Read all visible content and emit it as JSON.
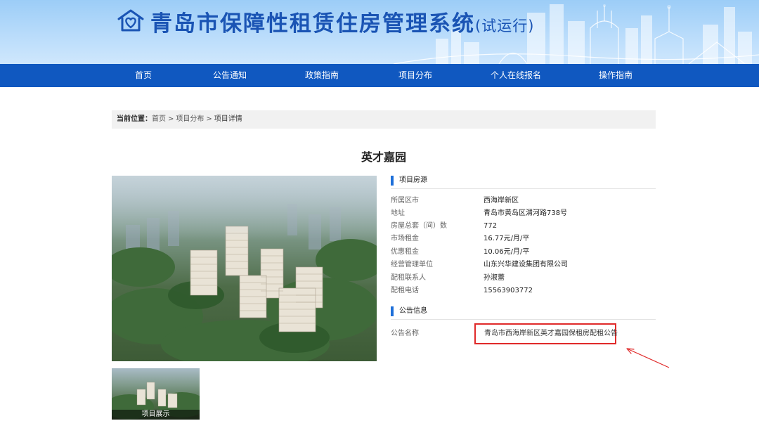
{
  "header": {
    "title": "青岛市保障性租赁住房管理系统",
    "title_suffix": "(试运行)",
    "logo_icon": "house-heart-icon"
  },
  "nav": {
    "items": [
      {
        "label": "首页"
      },
      {
        "label": "公告通知"
      },
      {
        "label": "政策指南"
      },
      {
        "label": "项目分布"
      },
      {
        "label": "个人在线报名"
      },
      {
        "label": "操作指南"
      }
    ]
  },
  "breadcrumb": {
    "label": "当前位置：",
    "items": [
      "首页",
      "项目分布",
      "项目详情"
    ],
    "separator": ">"
  },
  "project": {
    "title": "英才嘉园"
  },
  "gallery": {
    "thumb_caption": "项目展示"
  },
  "housing_section": {
    "heading": "项目房源",
    "rows": [
      {
        "key": "所属区市",
        "value": "西海岸新区"
      },
      {
        "key": "地址",
        "value": "青岛市黄岛区渭河路738号"
      },
      {
        "key": "房屋总套（间）数",
        "value": "772"
      },
      {
        "key": "市场租金",
        "value": "16.77元/月/平"
      },
      {
        "key": "优惠租金",
        "value": "10.06元/月/平"
      },
      {
        "key": "经营管理单位",
        "value": "山东兴华建设集团有限公司"
      },
      {
        "key": "配租联系人",
        "value": "孙淑蕾"
      },
      {
        "key": "配租电话",
        "value": "15563903772"
      }
    ]
  },
  "notice_section": {
    "heading": "公告信息",
    "rows": [
      {
        "key": "公告名称",
        "value": "青岛市西海岸新区英才嘉园保租房配租公告"
      }
    ]
  },
  "colors": {
    "nav_bg": "#1058c0",
    "title_blue": "#1a54b4",
    "section_bar": "#1e6fd9",
    "highlight_red": "#e02a2a"
  }
}
